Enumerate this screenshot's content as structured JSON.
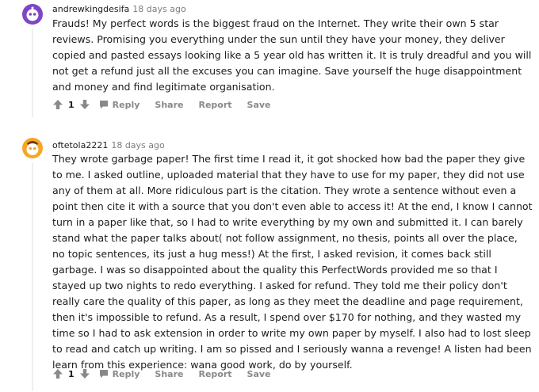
{
  "comments": [
    {
      "username": "andrewkingdesifa",
      "time": "18 days ago",
      "avatar_color": "#7f45c7",
      "text": "Frauds! My perfect words is the biggest fraud on the Internet. They write their own 5 star reviews. Promising you everything under the sun until they have your money, they deliver copied and pasted essays looking like a 5 year old has written it. It is truly dreadful and you will not get a refund just all the excuses you can imagine. Save yourself the huge disappointment and money and find legitimate organisation.",
      "score": "1",
      "actions": {
        "reply": "Reply",
        "share": "Share",
        "report": "Report",
        "save": "Save"
      }
    },
    {
      "username": "oftetola2221",
      "time": "18 days ago",
      "avatar_color": "#f5a623",
      "text": "They wrote garbage paper! The first time I read it, it got shocked how bad the paper they give to me. I asked outline, uploaded material that they have to use for my paper, they did not use any of them at all. More ridiculous part is the citation. They wrote a sentence without even a point then cite it with a source that you don't even able to access it! At the end, I know I cannot turn in a paper like that, so I had to write everything by my own and submitted it. I can barely stand what the paper talks about( not follow assignment, no thesis, points all over the place, no topic sentences, its just a hug mess!) At the first, I asked revision, it comes back still garbage. I was so disappointed about the quality this PerfectWords provided me so that I stayed up two nights to redo everything. I asked for refund. They told me their policy don't really care the quality of this paper, as long as they meet the deadline and page requirement, then it's impossible to refund. As a result, I spend over $170 for nothing, and they wasted my time so I had to ask extension in order to write my own paper by myself. I also had to lost sleep to read and catch up writing. I am so pissed and I seriously wanna a revenge! A listen had been learn from this experience: wana good work, do by yourself.",
      "score": "1",
      "actions": {
        "reply": "Reply",
        "share": "Share",
        "report": "Report",
        "save": "Save"
      }
    }
  ]
}
